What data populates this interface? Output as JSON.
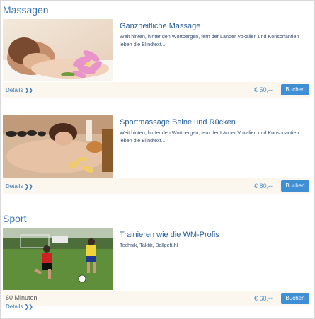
{
  "sections": {
    "massagen": {
      "title": "Massagen",
      "items": [
        {
          "title": "Ganzheitliche Massage",
          "description": "Weit hinten, hinter den Wortbergen, fern der Länder Vokalien und Konsonantien leben die Blindtext...",
          "details_label": "Details",
          "price": "€ 50,--",
          "buy_label": "Buchen"
        },
        {
          "title": "Sportmassage Beine und Rücken",
          "description": "Weit hinten, hinter den Wortbergen, fern der Länder Vokalien und Konsonantien leben die Blindtext...",
          "details_label": "Details",
          "price": "€ 80,--",
          "buy_label": "Buchen"
        }
      ]
    },
    "sport": {
      "title": "Sport",
      "items": [
        {
          "title": "Trainieren wie die WM-Profis",
          "description": "Technik, Taktik, Ballgefühl",
          "duration": "60 Minuten",
          "details_label": "Details",
          "price": "€ 60,--",
          "buy_label": "Buchen"
        }
      ]
    }
  },
  "colors": {
    "accent": "#3a78b5",
    "button": "#3e8fd4",
    "footer_bar": "#fbf7ee"
  },
  "icons": {
    "details_chevron": "double-chevron-right-icon"
  }
}
